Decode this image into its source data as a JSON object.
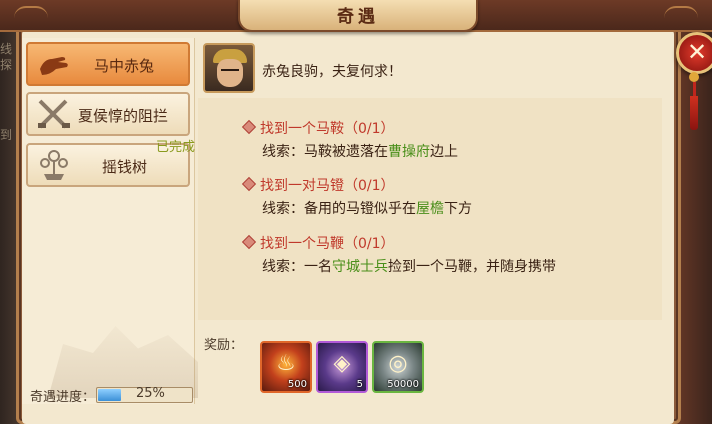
{
  "window": {
    "title": "奇遇"
  },
  "sidebar": {
    "items": [
      {
        "label": "马中赤兔",
        "icon": "hand-icon",
        "active": true
      },
      {
        "label": "夏侯惇的阻拦",
        "icon": "crossed-swords-icon",
        "active": false
      },
      {
        "label": "摇钱树",
        "icon": "money-tree-icon",
        "active": false
      }
    ],
    "done_tag": "已完成",
    "progress_label": "奇遇进度：",
    "progress_value": 0.25,
    "progress_text": "25%"
  },
  "dialog": {
    "text": "赤兔良驹，夫复何求！"
  },
  "tasks": [
    {
      "title": "找到一个马鞍（0/1）",
      "clue_prefix": "线索：马鞍被遗落在",
      "clue_highlight": "曹操府",
      "clue_suffix": "边上"
    },
    {
      "title": "找到一对马镫（0/1）",
      "clue_prefix": "线索：备用的马镫似乎在",
      "clue_highlight": "屋檐",
      "clue_suffix": "下方"
    },
    {
      "title": "找到一个马鞭（0/1）",
      "clue_prefix": "线索：一名",
      "clue_highlight": "守城士兵",
      "clue_suffix": "捡到一个马鞭，并随身携带"
    }
  ],
  "rewards": {
    "label": "奖励：",
    "items": [
      {
        "icon": "fire-orb-icon",
        "qty": "500",
        "color": "#e0672a"
      },
      {
        "icon": "purple-bag-icon",
        "qty": "5",
        "color": "#b25ad8"
      },
      {
        "icon": "coin-icon",
        "qty": "50000",
        "color": "#6ab640"
      }
    ]
  },
  "bg_left_text": [
    "线",
    "探",
    "到"
  ],
  "close_icon": "close-icon"
}
